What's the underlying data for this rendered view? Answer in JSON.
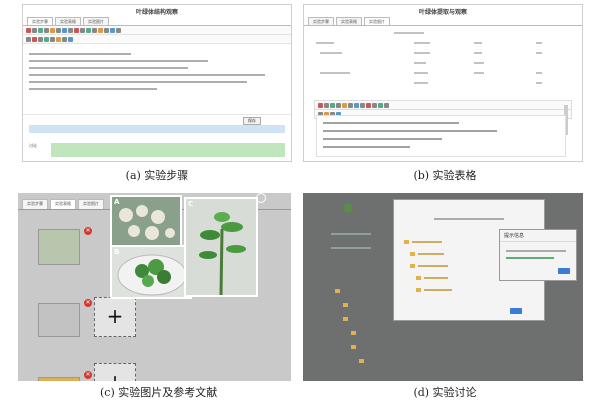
{
  "captions": {
    "a": "(a) 实验步骤",
    "b": "(b) 实验表格",
    "c": "(c) 实验图片及参考文献",
    "d": "(d) 实验讨论"
  },
  "panel_a": {
    "title": "叶绿体结构观察",
    "tabs": [
      "实验步骤",
      "实验表格",
      "实验图片"
    ],
    "button": "保存",
    "section_label": "讨论"
  },
  "panel_b": {
    "title": "叶绿体提取与观察",
    "tabs": [
      "实验步骤",
      "实验表格",
      "实验图片"
    ]
  },
  "panel_c": {
    "tabs": [
      "实验步骤",
      "实验表格",
      "实验图片"
    ],
    "photo_labels": [
      "A",
      "B",
      "C"
    ],
    "add_symbol": "+"
  },
  "panel_d": {
    "dialog_title": "提示信息",
    "dialog_button": "确定"
  },
  "colors": {
    "panel_border": "#cfcfcf",
    "blue_bar": "#cfe3f4",
    "green_box": "#bfe6bd",
    "delete_red": "#d23b2f",
    "dim_overlay": "#6e7070",
    "accent_blue": "#3a7bd5"
  }
}
